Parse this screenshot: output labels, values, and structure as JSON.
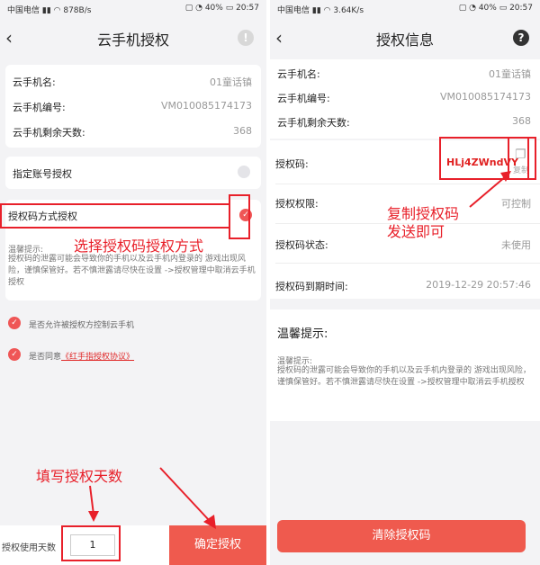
{
  "left": {
    "status": {
      "carrier": "中国电信",
      "speed": "878B/s",
      "battery": "40%",
      "time": "20:57"
    },
    "title": "云手机授权",
    "info": [
      {
        "label": "云手机名:",
        "value": "01童话镇"
      },
      {
        "label": "云手机编号:",
        "value": "VM010085174173"
      },
      {
        "label": "云手机剩余天数:",
        "value": "368"
      }
    ],
    "option_account": "指定账号授权",
    "option_code": "授权码方式授权",
    "tip_title": "温馨提示:",
    "tip_text": "授权码的泄露可能会导致你的手机以及云手机内登录的 游戏出现风险，谨慎保管好。若不慎泄露请尽快在设置 ->授权管理中取消云手机授权",
    "agree_control": "是否允许被授权方控制云手机",
    "agree_prefix": "是否同意",
    "agree_link": "《红手指授权协议》",
    "days_label": "授权使用天数",
    "days_value": "1",
    "confirm": "确定授权",
    "annot_select": "选择授权码授权方式",
    "annot_days": "填写授权天数"
  },
  "right": {
    "status": {
      "carrier": "中国电信",
      "speed": "3.64K/s",
      "battery": "40%",
      "time": "20:57"
    },
    "title": "授权信息",
    "help": "?",
    "info": [
      {
        "label": "云手机名:",
        "value": "01童话镇"
      },
      {
        "label": "云手机编号:",
        "value": "VM010085174173"
      },
      {
        "label": "云手机剩余天数:",
        "value": "368"
      }
    ],
    "code_label": "授权码:",
    "code_value": "HLj4ZWndVY",
    "copy_label": "复制",
    "perm_label": "授权权限:",
    "perm_value": "可控制",
    "state_label": "授权码状态:",
    "state_value": "未使用",
    "expire_label": "授权码到期时间:",
    "expire_value": "2019-12-29 20:57:46",
    "tip_heading": "温馨提示:",
    "tip_title": "温馨提示:",
    "tip_text": "授权码的泄露可能会导致你的手机以及云手机内登录的 游戏出现风险，谨慎保管好。若不慎泄露请尽快在设置 ->授权管理中取消云手机授权",
    "clear_button": "清除授权码",
    "annot_copy_1": "复制授权码",
    "annot_copy_2": "发送即可"
  },
  "colors": {
    "accent": "#ef5a4e",
    "annotation": "#e8202a"
  }
}
